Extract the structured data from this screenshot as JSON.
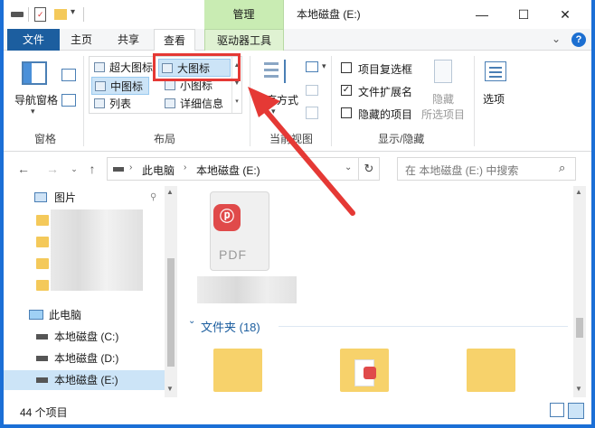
{
  "title_bar": {
    "manage_tab": "管理",
    "window_title": "本地磁盘 (E:)",
    "minimize": "—",
    "maximize": "☐",
    "close": "✕"
  },
  "tabs": {
    "file": "文件",
    "home": "主页",
    "share": "共享",
    "view": "查看",
    "drive_tools": "驱动器工具",
    "collapse": "⌄",
    "help": "?"
  },
  "ribbon": {
    "nav_pane": "导航窗格",
    "group_panes": "窗格",
    "layouts": {
      "extra_large": "超大图标",
      "large": "大图标",
      "medium": "中图标",
      "small": "小图标",
      "list": "列表",
      "details": "详细信息"
    },
    "group_layout": "布局",
    "sort": "排序方式",
    "group_current_view": "当前视图",
    "item_checkboxes": "项目复选框",
    "file_extensions": "文件扩展名",
    "hidden_items": "隐藏的项目",
    "file_extensions_checked": true,
    "hide_btn_line1": "隐藏",
    "hide_btn_line2": "所选项目",
    "options": "选项",
    "group_show_hide": "显示/隐藏"
  },
  "address": {
    "this_pc": "此电脑",
    "drive": "本地磁盘 (E:)",
    "search_placeholder": "在 本地磁盘 (E:) 中搜索"
  },
  "nav": {
    "pictures": "图片",
    "this_pc": "此电脑",
    "drive_c": "本地磁盘 (C:)",
    "drive_d": "本地磁盘 (D:)",
    "drive_e": "本地磁盘 (E:)"
  },
  "content": {
    "pdf_label": "PDF",
    "folder_group": "文件夹 (18)"
  },
  "status": {
    "count": "44 个项目"
  },
  "colors": {
    "accent": "#1c5e9f",
    "manage_green": "#c9ecb3",
    "highlight_red": "#e53935",
    "selection": "#cce4f7"
  }
}
